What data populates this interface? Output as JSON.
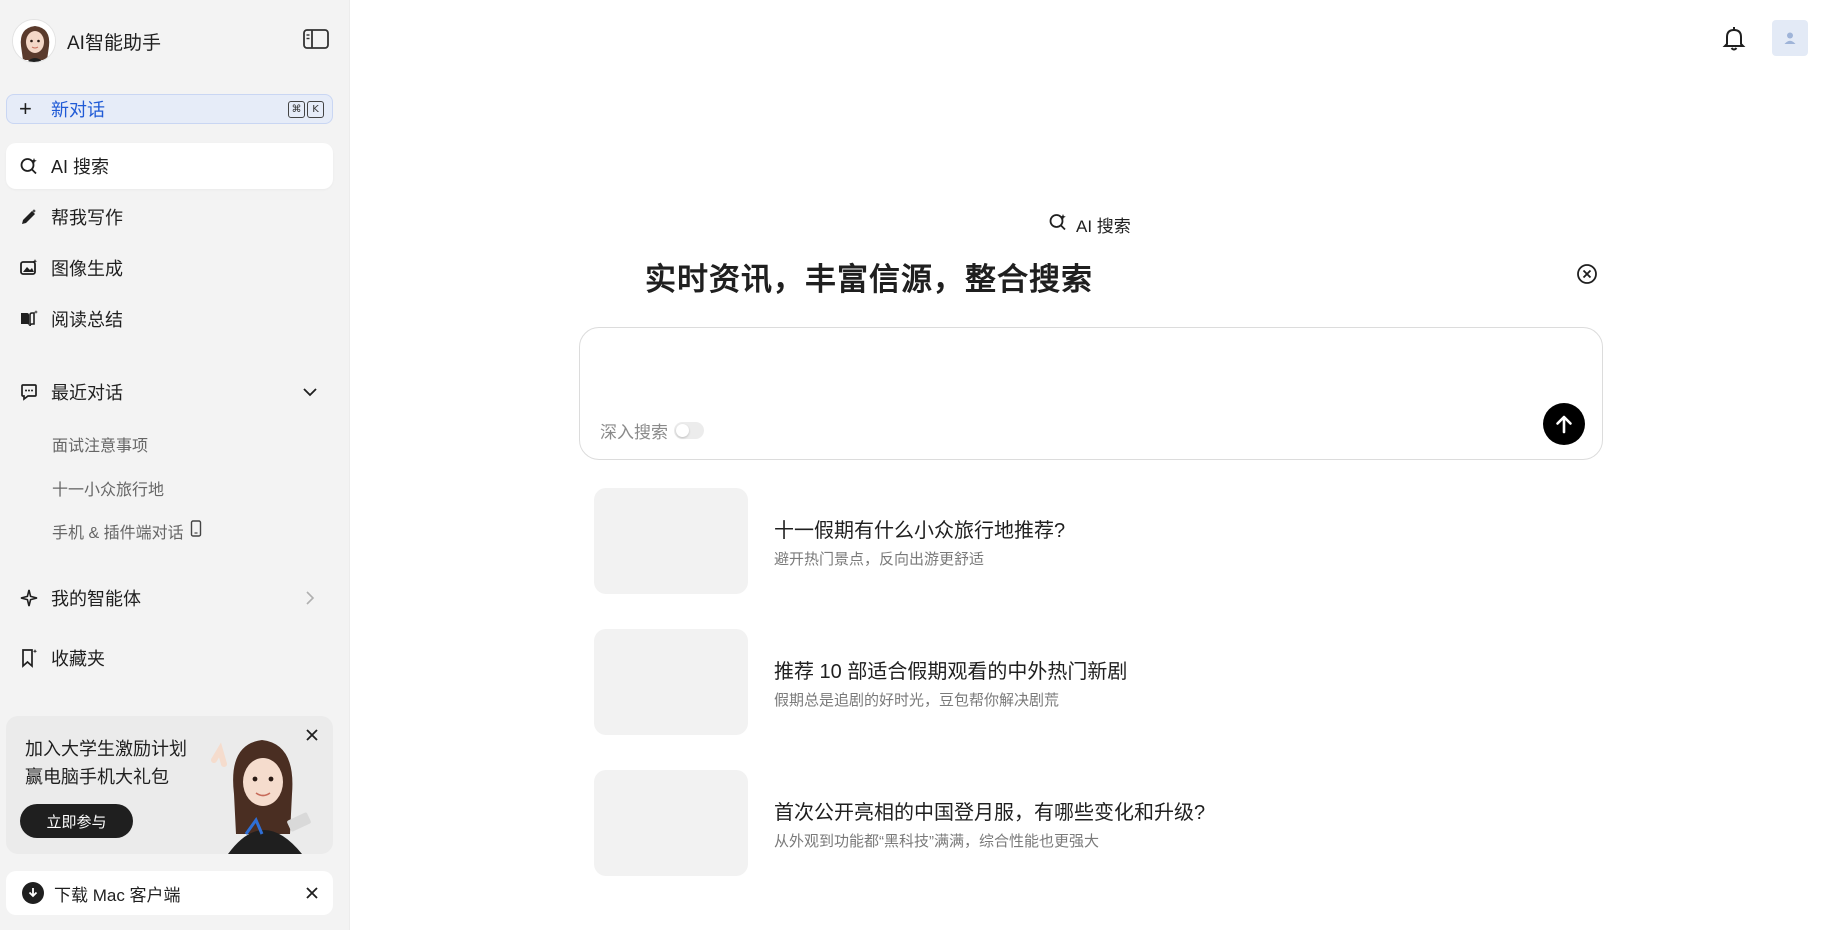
{
  "sidebar": {
    "brand_name": "AI智能助手",
    "new_chat_label": "新对话",
    "shortcut_keys": [
      "⌘",
      "K"
    ],
    "nav": [
      {
        "label": "AI 搜索",
        "icon": "ai-search-icon",
        "active": true
      },
      {
        "label": "帮我写作",
        "icon": "pen-icon"
      },
      {
        "label": "图像生成",
        "icon": "image-icon"
      },
      {
        "label": "阅读总结",
        "icon": "book-icon"
      }
    ],
    "recent_label": "最近对话",
    "recent_items": [
      "面试注意事项",
      "十一小众旅行地",
      "手机 & 插件端对话"
    ],
    "agents_label": "我的智能体",
    "favorites_label": "收藏夹",
    "promo": {
      "line1": "加入大学生激励计划",
      "line2": "赢电脑手机大礼包",
      "button": "立即参与"
    },
    "download_label": "下载 Mac 客户端"
  },
  "main": {
    "mode_label": "AI 搜索",
    "headline": "实时资讯，丰富信源，整合搜索",
    "input": {
      "deep_search_label": "深入搜索"
    },
    "suggestions": [
      {
        "title": "十一假期有什么小众旅行地推荐?",
        "subtitle": "避开热门景点，反向出游更舒适"
      },
      {
        "title": "推荐 10 部适合假期观看的中外热门新剧",
        "subtitle": "假期总是追剧的好时光，豆包帮你解决剧荒"
      },
      {
        "title": "首次公开亮相的中国登月服，有哪些变化和升级?",
        "subtitle": "从外观到功能都“黑科技”满满，综合性能也更强大"
      }
    ]
  },
  "colors": {
    "accent_blue": "#1f5ad6",
    "sidebar_bg": "#f3f3f3",
    "send_button": "#000000"
  }
}
